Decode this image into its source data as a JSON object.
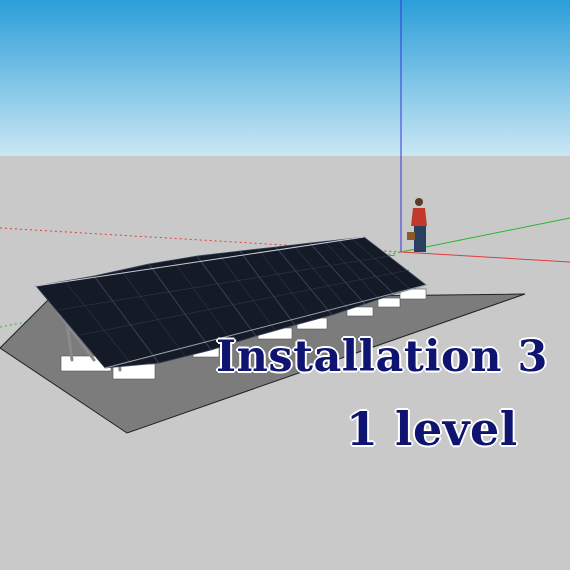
{
  "colors": {
    "sky_top": "#2b9ed9",
    "sky_bottom": "#cbe7f4",
    "ground": "#c9c9ca",
    "pad": "#7c7c7d",
    "panel": "#141a26",
    "panel_grid": "#2c3a52",
    "caption": "#0e1470",
    "axis_red": "#e03c3c",
    "axis_green": "#2db52d",
    "axis_blue": "#3535d8"
  },
  "scene": {
    "panel_count": 8,
    "icons": {
      "person": "person-scale-figure-icon",
      "axes": "model-axes-icon"
    }
  },
  "caption": {
    "line1": "Installation 3",
    "line2": "1 level"
  }
}
